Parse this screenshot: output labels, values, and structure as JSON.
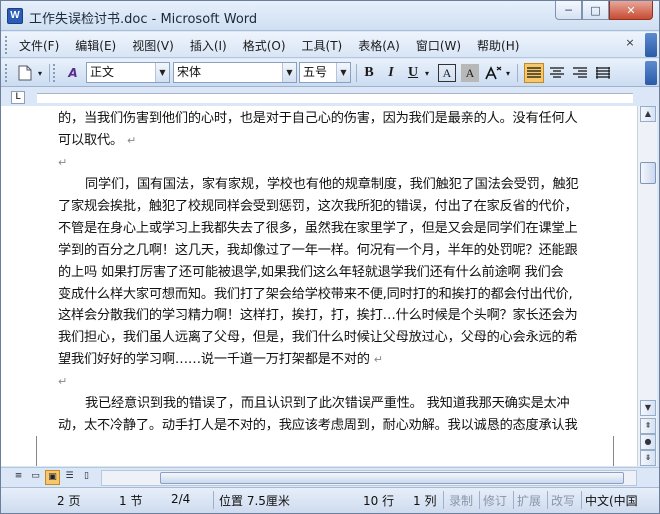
{
  "window": {
    "title": "工作失误检讨书.doc - Microsoft Word",
    "app_icon_letter": "W",
    "buttons": {
      "minimize": "─",
      "maximize": "□",
      "close": "✕"
    }
  },
  "menu": {
    "items": [
      "文件(F)",
      "编辑(E)",
      "视图(V)",
      "插入(I)",
      "格式(O)",
      "工具(T)",
      "表格(A)",
      "窗口(W)",
      "帮助(H)"
    ],
    "close_doc": "×"
  },
  "toolbar": {
    "style": "正文",
    "font": "宋体",
    "size": "五号",
    "bold": "B",
    "italic": "I",
    "underline": "U",
    "char_border": "A",
    "char_shading": "A",
    "styles_icon": "A"
  },
  "ruler": {
    "tab_selector": "L"
  },
  "document": {
    "paragraphs": [
      {
        "lines": [
          "的，当我们伤害到他们的心时，也是对于自己心的伤害，因为我们是最亲的人。没有任何人",
          "可以取代。"
        ],
        "mark": "↵"
      },
      {
        "lines": [
          ""
        ],
        "mark": "↵"
      },
      {
        "lines": [
          "同学们，国有国法，家有家规，学校也有他的规章制度，我们触犯了国法会受罚，触犯",
          "了家规会挨批，触犯了校规同样会受到惩罚，这次我所犯的错误，付出了在家反省的代价，",
          "不管是在身心上或学习上我都失去了很多，虽然我在家里学了，但是又会是同学们在课堂上",
          "学到的百分之几啊！这几天，我却像过了一年一样。何况有一个月，半年的处罚呢？还能跟",
          "的上吗 如果打厉害了还可能被退学,如果我们这么年轻就退学我们还有什么前途啊 我们会",
          "变成什么样大家可想而知。我们打了架会给学校带来不便,同时打的和挨打的都会付出代价,",
          "这样会分散我们的学习精力啊！这样打，挨打，打，挨打…什么时候是个头啊？家长还会为",
          "我们担心，我们虽人远离了父母，但是，我们什么时候让父母放过心，父母的心会永远的希",
          "望我们好好的学习啊……说一千道一万打架都是不对的"
        ],
        "mark": "↵"
      },
      {
        "lines": [
          ""
        ],
        "mark": "↵"
      },
      {
        "lines": [
          "我已经意识到我的错误了，而且认识到了此次错误严重性。 我知道我那天确实是太冲",
          "动，太不冷静了。动手打人是不对的，我应该考虑周到，耐心劝解。我以诚恳的态度承认我"
        ],
        "mark": ""
      }
    ]
  },
  "statusbar": {
    "page": "2 页",
    "section": "1 节",
    "page_of": "2/4",
    "position": "位置 7.5厘米",
    "line": "10 行",
    "column": "1 列",
    "rec": "录制",
    "trk": "修订",
    "ext": "扩展",
    "ovr": "改写",
    "language": "中文(中国"
  }
}
